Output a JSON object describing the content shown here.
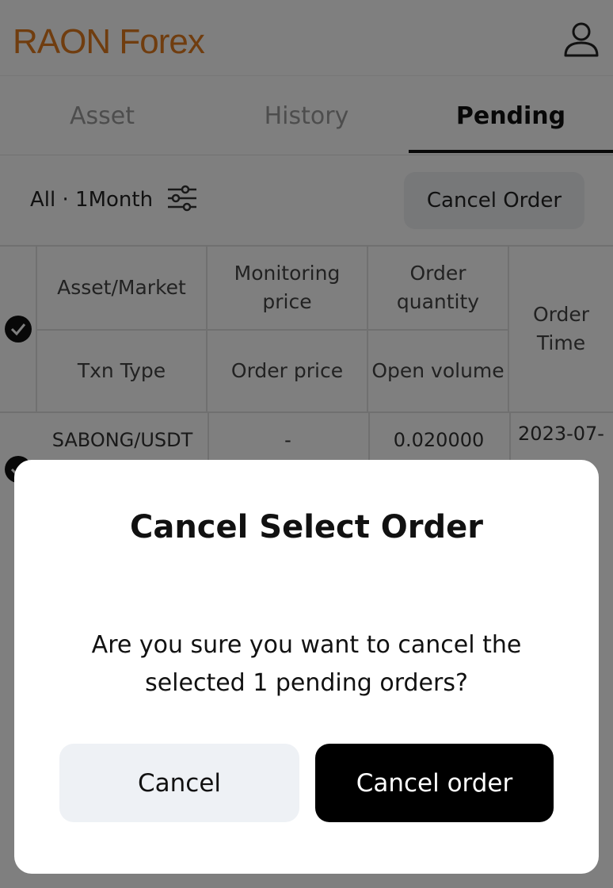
{
  "app": {
    "logo": "RAON Forex"
  },
  "tabs": [
    {
      "label": "Asset",
      "active": false
    },
    {
      "label": "History",
      "active": false
    },
    {
      "label": "Pending",
      "active": true
    }
  ],
  "filter": {
    "label": "All · 1Month",
    "cancel_order_label": "Cancel Order"
  },
  "table": {
    "headers": {
      "asset_market": "Asset/Market",
      "monitoring_price": "Monitoring price",
      "order_quantity": "Order quantity",
      "order_time": "Order Time",
      "txn_type": "Txn Type",
      "order_price": "Order price",
      "open_volume": "Open volume"
    },
    "rows": [
      {
        "asset_market": "SABONG/USDT",
        "monitoring_price": "-",
        "order_quantity": "0.020000",
        "order_time": "2023-07-"
      }
    ]
  },
  "modal": {
    "title": "Cancel Select Order",
    "message": "Are you sure you want to cancel the selected 1 pending orders?",
    "cancel_label": "Cancel",
    "confirm_label": "Cancel order"
  },
  "colors": {
    "brand": "#e07b1f",
    "primary": "#000000",
    "secondary_button": "#eef1f5"
  }
}
